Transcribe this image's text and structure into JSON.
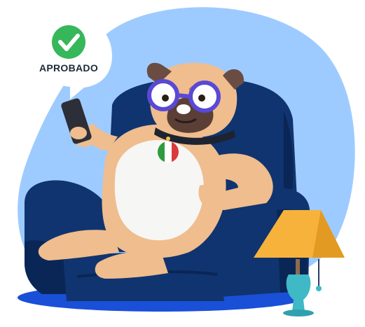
{
  "speech_bubble": {
    "status_label": "APROBADO",
    "status_icon": "check-icon"
  },
  "colors": {
    "backdrop_blob": "#9ecbff",
    "armchair": "#10346f",
    "armchair_shadow": "#0a2656",
    "floor_shadow": "#1a4fd8",
    "dog_fur": "#efbd8e",
    "dog_belly": "#f6f6f4",
    "dog_ears": "#6b4c43",
    "glasses": "#5a48d6",
    "collar": "#1d2330",
    "phone": "#2c2f37",
    "lampshade": "#f7b23c",
    "lamp_base": "#3fb9c6",
    "check_green": "#35b75a"
  }
}
